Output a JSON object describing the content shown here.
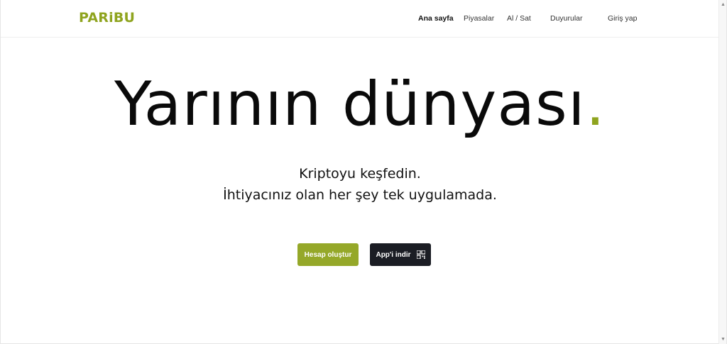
{
  "header": {
    "logo": "PARiBU",
    "nav": [
      {
        "label": "Ana sayfa"
      },
      {
        "label": "Piyasalar"
      },
      {
        "label": "Al / Sat"
      },
      {
        "label": "Duyurular"
      },
      {
        "label": "Giriş yap"
      }
    ]
  },
  "hero": {
    "headline": "Yarının dünyası",
    "headline_dot": ".",
    "line1": "Kriptoyu keşfedin.",
    "line2": "İhtiyacınız olan her şey tek uygulamada."
  },
  "actions": {
    "signup_label": "Hesap oluştur",
    "download_label": "App'i indir",
    "download_icon": "qr-code-icon"
  },
  "colors": {
    "brand_green": "#95a829",
    "dark_button": "#1b1d24"
  }
}
